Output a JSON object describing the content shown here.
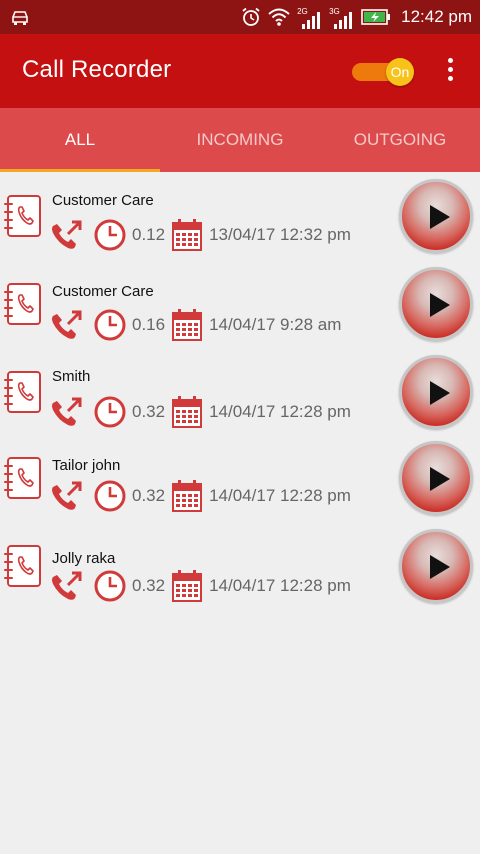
{
  "status_bar": {
    "time": "12:42 pm",
    "net_2g": "2G",
    "net_3g": "3G"
  },
  "toolbar": {
    "title": "Call Recorder",
    "toggle_label": "On"
  },
  "tabs": [
    {
      "label": "ALL",
      "active": true
    },
    {
      "label": "INCOMING",
      "active": false
    },
    {
      "label": "OUTGOING",
      "active": false
    }
  ],
  "recordings": [
    {
      "name": "Customer Care",
      "duration": "0.12",
      "datetime": "13/04/17 12:32 pm"
    },
    {
      "name": "Customer Care",
      "duration": "0.16",
      "datetime": "14/04/17 9:28 am"
    },
    {
      "name": "Smith",
      "duration": "0.32",
      "datetime": "14/04/17 12:28 pm"
    },
    {
      "name": "Tailor john",
      "duration": "0.32",
      "datetime": "14/04/17 12:28 pm"
    },
    {
      "name": "Jolly raka",
      "duration": "0.32",
      "datetime": "14/04/17 12:28 pm"
    }
  ],
  "colors": {
    "accent": "#c41010",
    "tab_bg": "#dc4a4c",
    "indicator": "#f5a623",
    "icon_red": "#d13a3a"
  }
}
